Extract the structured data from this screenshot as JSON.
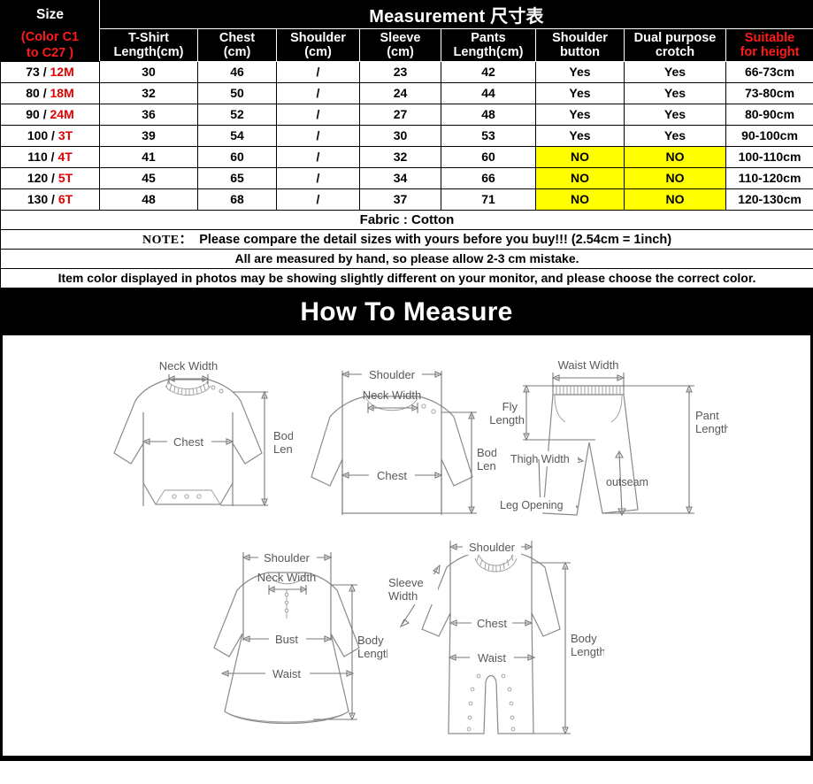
{
  "table": {
    "size_header": {
      "title": "Size",
      "subtitle_line1": "(Color C1",
      "subtitle_line2": "to C27 )"
    },
    "measurement_title_en": "Measurement",
    "measurement_title_cn": "尺寸表",
    "columns": [
      "T-Shirt Length(cm)",
      "Chest (cm)",
      "Shoulder (cm)",
      "Sleeve (cm)",
      "Pants Length(cm)",
      "Shoulder button",
      "Dual purpose crotch",
      "Suitable for height"
    ],
    "columns_lines": [
      [
        "T-Shirt",
        "Length(cm)"
      ],
      [
        "Chest",
        "(cm)"
      ],
      [
        "Shoulder",
        "(cm)"
      ],
      [
        "Sleeve",
        "(cm)"
      ],
      [
        "Pants",
        "Length(cm)"
      ],
      [
        "Shoulder",
        "button"
      ],
      [
        "Dual purpose",
        "crotch"
      ],
      [
        "Suitable",
        "for height"
      ]
    ],
    "rows": [
      {
        "size_num": "73 / ",
        "size_age": "12M",
        "tshirt_length": "30",
        "chest": "46",
        "shoulder": "/",
        "sleeve": "23",
        "pants_length": "42",
        "shoulder_button": "Yes",
        "dual_crotch": "Yes",
        "height": "66-73cm",
        "highlight": false
      },
      {
        "size_num": "80 / ",
        "size_age": "18M",
        "tshirt_length": "32",
        "chest": "50",
        "shoulder": "/",
        "sleeve": "24",
        "pants_length": "44",
        "shoulder_button": "Yes",
        "dual_crotch": "Yes",
        "height": "73-80cm",
        "highlight": false
      },
      {
        "size_num": "90 / ",
        "size_age": "24M",
        "tshirt_length": "36",
        "chest": "52",
        "shoulder": "/",
        "sleeve": "27",
        "pants_length": "48",
        "shoulder_button": "Yes",
        "dual_crotch": "Yes",
        "height": "80-90cm",
        "highlight": false
      },
      {
        "size_num": "100 / ",
        "size_age": "3T",
        "tshirt_length": "39",
        "chest": "54",
        "shoulder": "/",
        "sleeve": "30",
        "pants_length": "53",
        "shoulder_button": "Yes",
        "dual_crotch": "Yes",
        "height": "90-100cm",
        "highlight": false
      },
      {
        "size_num": "110 / ",
        "size_age": "4T",
        "tshirt_length": "41",
        "chest": "60",
        "shoulder": "/",
        "sleeve": "32",
        "pants_length": "60",
        "shoulder_button": "NO",
        "dual_crotch": "NO",
        "height": "100-110cm",
        "highlight": true
      },
      {
        "size_num": "120 / ",
        "size_age": "5T",
        "tshirt_length": "45",
        "chest": "65",
        "shoulder": "/",
        "sleeve": "34",
        "pants_length": "66",
        "shoulder_button": "NO",
        "dual_crotch": "NO",
        "height": "110-120cm",
        "highlight": true
      },
      {
        "size_num": "130 / ",
        "size_age": "6T",
        "tshirt_length": "48",
        "chest": "68",
        "shoulder": "/",
        "sleeve": "37",
        "pants_length": "71",
        "shoulder_button": "NO",
        "dual_crotch": "NO",
        "height": "120-130cm",
        "highlight": true
      }
    ],
    "notes": {
      "fabric_label": "Fabric",
      "fabric_value": " : Cotton",
      "note_tag": "NOTE：",
      "note_text": "Please compare the detail sizes with yours before you buy!!! (2.54cm = 1inch)",
      "measure_note": "All are measured by hand, so please allow 2-3 cm mistake.",
      "color_note": "Item color displayed in photos may be showing slightly different on your monitor, and please choose the correct color."
    }
  },
  "banner": {
    "title": "How To Measure"
  },
  "diagrams": {
    "bodysuit": {
      "name": "bodysuit",
      "labels": {
        "neck_width": "Neck Width",
        "chest": "Chest",
        "body_length_1": "Body",
        "body_length_2": "Length"
      }
    },
    "sweater": {
      "name": "sweater",
      "labels": {
        "shoulder": "Shoulder",
        "neck_width": "Neck Width",
        "chest": "Chest",
        "body_length_1": "Body",
        "body_length_2": "Length"
      }
    },
    "pants": {
      "name": "pants",
      "labels": {
        "waist_width": "Waist Width",
        "fly_length_1": "Fly",
        "fly_length_2": "Length",
        "thigh_width": "Thigh Width",
        "leg_opening": "Leg Opening",
        "outseam": "outseam",
        "pant_length_1": "Pant",
        "pant_length_2": "Length"
      }
    },
    "dress": {
      "name": "dress",
      "labels": {
        "shoulder": "Shoulder",
        "neck_width": "Neck Width",
        "bust": "Bust",
        "waist": "Waist",
        "body_length_1": "Body",
        "body_length_2": "Length"
      }
    },
    "romper": {
      "name": "romper",
      "labels": {
        "shoulder": "Shoulder",
        "sleeve_width_1": "Sleeve",
        "sleeve_width_2": "Width",
        "chest": "Chest",
        "waist": "Waist",
        "body_length_1": "Body",
        "body_length_2": "Length"
      }
    }
  },
  "colors": {
    "header_bg": "#000000",
    "header_text": "#ffffff",
    "accent_red": "#ff1a1a",
    "data_red": "#e00000",
    "highlight_yellow": "#ffff00",
    "note_red": "#ee0000",
    "diagram_stroke": "#8a8a8a",
    "diagram_label": "#595959"
  }
}
